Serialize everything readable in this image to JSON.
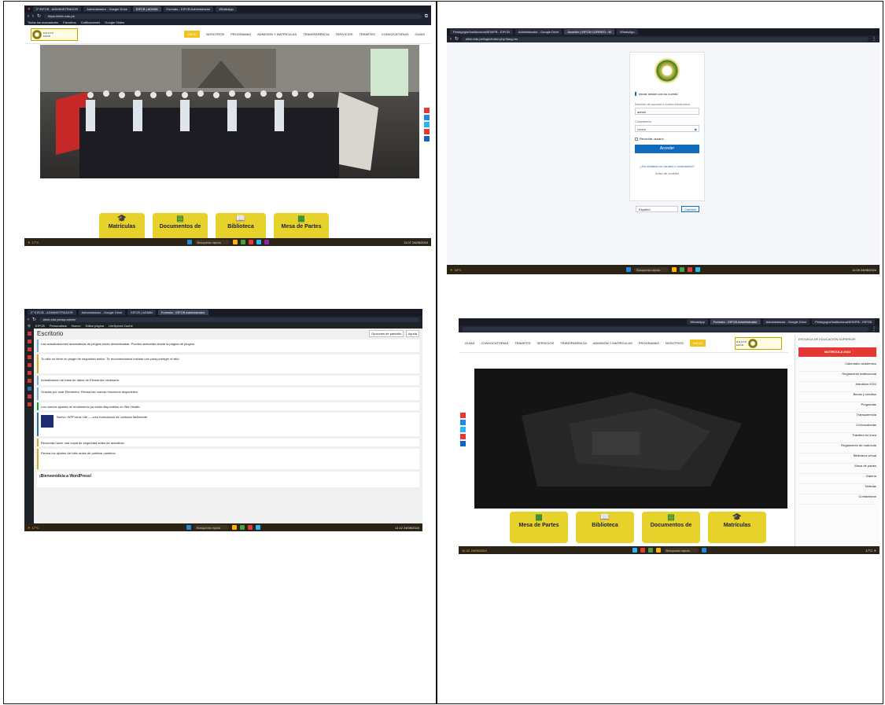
{
  "shot1": {
    "tabs": [
      "2° EIFCB - ADMINISTRADOR",
      "Administrador - Google Drive",
      "EIFCB | ADMIN",
      "Formato - EIFCB Administrador",
      "WhatsApp"
    ],
    "url": "https://eifcb.edu.pe",
    "bookmarks": [
      "Todos los marcadores",
      "Favoritos",
      "Calificaciones",
      "Google Slides"
    ],
    "nav": [
      "INICIO",
      "NOSOTROS",
      "PROGRAMAS",
      "ADMISIÓN Y MATRÍCULAS",
      "TRANSPARENCIA",
      "SERVICIOS",
      "TRÁMITES",
      "CONVOCATORIAS",
      "GUÍAS"
    ],
    "cards": [
      "Matrículas",
      "Documentos de",
      "Biblioteca",
      "Mesa de Partes"
    ],
    "taskbar": {
      "weather": "17°C",
      "search": "Búsqueda rápida",
      "time": "11:07",
      "date": "24/06/2024"
    }
  },
  "shot2": {
    "tabs": [
      "Pedagogía/Institucional/IES/IFB - EIFCB",
      "Administrador - Google Drive",
      "Acceder | EIFCB CORREO - W",
      "WhatsApp"
    ],
    "url": "eifcb.edu.pe/login/index.php?lang=es",
    "form": {
      "title": "Iniciar sesión con su cuenta",
      "user_label": "Nombre de usuario o correo electrónico",
      "user_value": "admin",
      "pass_label": "Contraseña",
      "pass_value": "••••••••",
      "remember": "Recordar usuario",
      "submit": "Acceder",
      "forgot": "¿Ha olvidado su usuario o contraseña?",
      "cookies": "Aviso de cookies"
    },
    "lang": {
      "value": "Español",
      "button": "Cambiar"
    },
    "taskbar": {
      "weather": "18°C",
      "search": "Búsqueda rápida",
      "time": "11:09",
      "date": "24/06/2024"
    }
  },
  "shot3": {
    "tabs": [
      "2° EIFCB - ADMINISTRADOR",
      "Administrador - Google Drive",
      "EIFCB | ADMIN",
      "Formato - EIFCB Administrador"
    ],
    "url": "eifcb.edu.pe/wp-admin/",
    "adminbar": [
      "EIFCB",
      "Personalizar",
      "Nuevo",
      "Editar página",
      "LiteSpeed Cache"
    ],
    "heading": "Escritorio",
    "screen_options": [
      "Opciones de pantalla",
      "Ayuda"
    ],
    "notices": [
      "Las actualizaciones automáticas de plugins están desactivadas. Puedes activarlas desde la página de plugins.",
      "Tu sitio no tiene un plugin de seguridad activo. Te recomendamos instalar uno para proteger el sitio.",
      "Actualización de base de datos de Elementor necesaria.",
      "Gracias por usar Elementor. Revisa las nuevas funciones disponibles.",
      "Los nuevos ajustes de rendimiento ya están disponibles en Site Health.",
      "Nuevo: WPForms Lite — crea formularios de contacto fácilmente.",
      "Recuerda hacer una copia de seguridad antes de actualizar.",
      "Revisa los ajustes del sitio antes de publicar cambios."
    ],
    "bottom_title": "¡Bienvenido/a a WordPress!",
    "taskbar": {
      "weather": "17°C",
      "search": "Búsqueda rápida",
      "time": "11:12",
      "date": "24/06/2024"
    }
  },
  "shot4": {
    "tabs": [
      "WhatsApp",
      "Formato - EIFCB Administrador",
      "Administrador - Google Drive",
      "Pedagogía/Institucional/IES/IFB - EIFCB"
    ],
    "nav": [
      "INICIO",
      "NOSOTROS",
      "PROGRAMAS",
      "ADMISIÓN Y MATRÍCULAS",
      "TRANSPARENCIA",
      "SERVICIOS",
      "TRÁMITES",
      "CONVOCATORIAS",
      "GUÍAS"
    ],
    "cards": [
      "Matrículas",
      "Documentos de",
      "Biblioteca",
      "Mesa de Partes"
    ],
    "sidebar": {
      "title": "ESCUELA DE EDUCACIÓN SUPERIOR",
      "button": "MATRICULA 2024",
      "items": [
        "Calendario académico",
        "Reglamento institucional",
        "Admisión 2024",
        "Becas y créditos",
        "Programas",
        "Transparencia",
        "Convocatorias",
        "Trámites en línea",
        "Reglamento de matrícula",
        "Biblioteca virtual",
        "Mesa de partes",
        "Galería",
        "Noticias",
        "Contáctanos"
      ]
    },
    "taskbar": {
      "weather": "17°C",
      "search": "Búsqueda rápida",
      "time": "11:15",
      "date": "24/06/2024"
    }
  }
}
